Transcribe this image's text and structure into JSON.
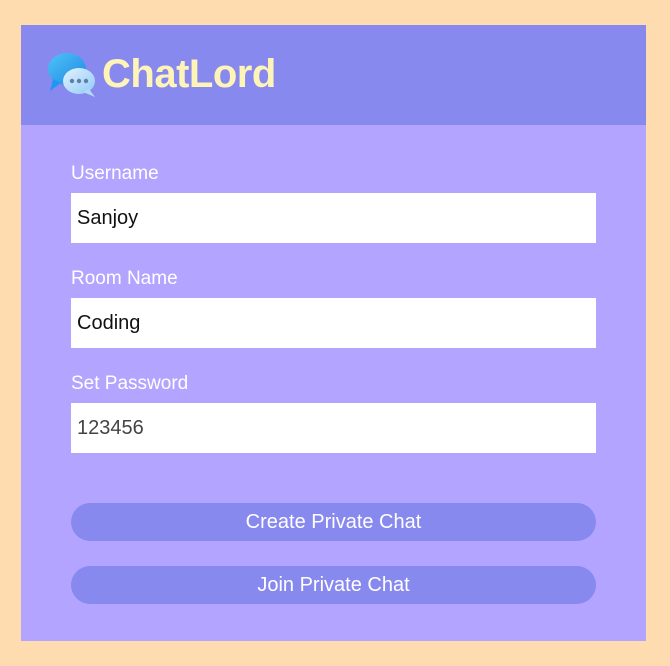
{
  "app": {
    "name": "ChatLord",
    "logo_icon": "chat-bubbles-icon",
    "colors": {
      "background": "#ffdcb0",
      "card": "#b3a5ff",
      "header": "#8789ee",
      "brand_text": "#fff4b8",
      "button": "#8789ee"
    }
  },
  "form": {
    "username": {
      "label": "Username",
      "value": "Sanjoy"
    },
    "room_name": {
      "label": "Room Name",
      "value": "Coding"
    },
    "password": {
      "label": "Set Password",
      "value": "123456"
    }
  },
  "buttons": {
    "create_label": "Create Private Chat",
    "join_label": "Join Private Chat"
  }
}
